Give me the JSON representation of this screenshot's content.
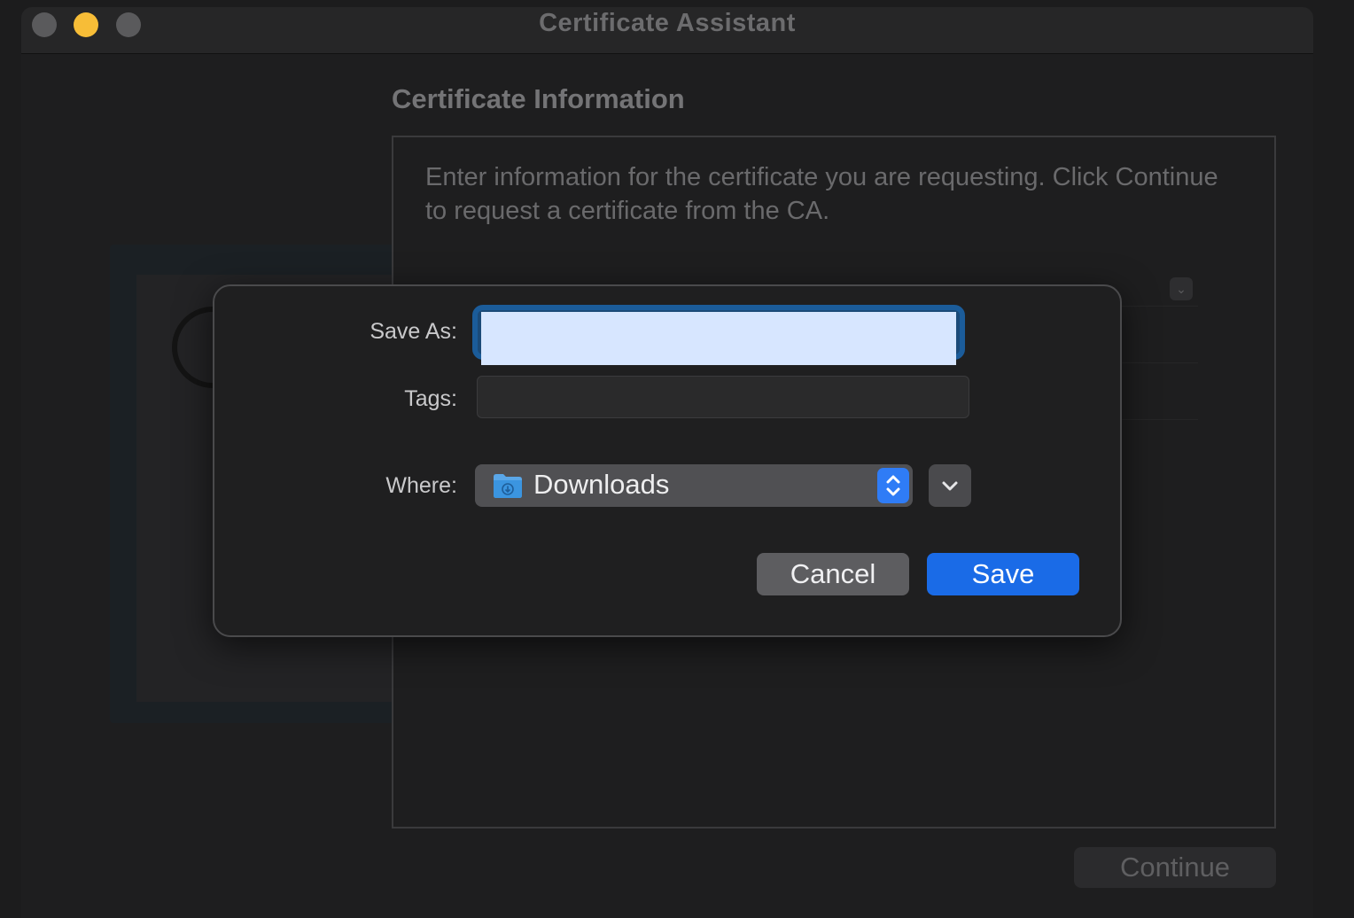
{
  "window": {
    "title": "Certificate Assistant"
  },
  "page": {
    "heading": "Certificate Information",
    "description": "Enter information for the certificate you are requesting. Click Continue to request a certificate from the CA.",
    "continue_label": "Continue"
  },
  "save_sheet": {
    "save_as_label": "Save As:",
    "save_as_value": "",
    "tags_label": "Tags:",
    "tags_value": "",
    "where_label": "Where:",
    "where_value": "Downloads",
    "where_icon": "downloads-folder-icon",
    "cancel_label": "Cancel",
    "save_label": "Save"
  },
  "colors": {
    "accent": "#1a6be7",
    "focus_ring": "#1b5c9a",
    "close_light": "#5a5a5c",
    "minimize_light": "#f7bd37",
    "zoom_light": "#5a5a5c"
  }
}
